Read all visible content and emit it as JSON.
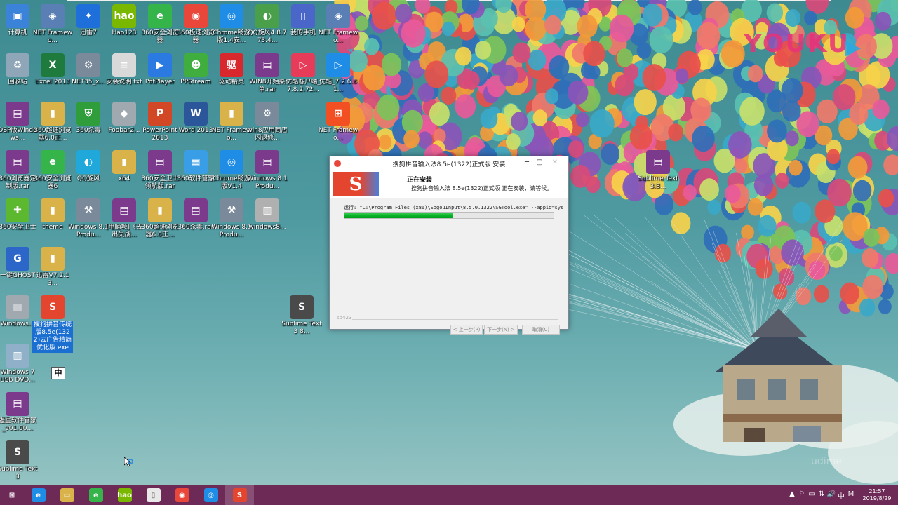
{
  "watermark": {
    "brand": "YOUKU",
    "corner": "udime"
  },
  "desktop_icons": [
    {
      "label": "计算机",
      "color": "#3b83d9",
      "glyph": "▣"
    },
    {
      "label": "NET Framewo...",
      "color": "#5a7fb5",
      "glyph": "◈"
    },
    {
      "label": "迅雷7",
      "color": "#1e6fd9",
      "glyph": "✦"
    },
    {
      "label": "Hao123",
      "color": "#7ab800",
      "glyph": "hao"
    },
    {
      "label": "360安全浏览器",
      "color": "#35b44a",
      "glyph": "e"
    },
    {
      "label": "360极速浏览器",
      "color": "#e8473a",
      "glyph": "◉"
    },
    {
      "label": "Chrome畅游版1.4安...",
      "color": "#1f8ce6",
      "glyph": "◎"
    },
    {
      "label": "QQ旋风4.8.773.4...",
      "color": "#4aa04a",
      "glyph": "◐"
    },
    {
      "label": "我的手机",
      "color": "#4a66c8",
      "glyph": "▯"
    },
    {
      "label": "NET Framewo...",
      "color": "#5a7fb5",
      "glyph": "◈"
    },
    {
      "label": "回收站",
      "color": "#8fa6b8",
      "glyph": "♻"
    },
    {
      "label": "Excel 2013",
      "color": "#1f7a3d",
      "glyph": "X"
    },
    {
      "label": "NET35_x...",
      "color": "#7a8a9a",
      "glyph": "⚙"
    },
    {
      "label": "安装说明.txt",
      "color": "#d9d9d9",
      "glyph": "≡"
    },
    {
      "label": "PotPlayer",
      "color": "#2a7ae2",
      "glyph": "▶"
    },
    {
      "label": "PPStream",
      "color": "#3fae3f",
      "glyph": "☻"
    },
    {
      "label": "驱动精灵",
      "color": "#d9272e",
      "glyph": "驱"
    },
    {
      "label": "WIN8开始菜单.rar",
      "color": "#7b3a8c",
      "glyph": "▤"
    },
    {
      "label": "优酷客户端_7.8.2.72...",
      "color": "#e63c5a",
      "glyph": "▷"
    },
    {
      "label": "优酷_7.2.6.81...",
      "color": "#1f8ce6",
      "glyph": "▷"
    },
    {
      "label": "DSP版Windows...",
      "color": "#7b3a8c",
      "glyph": "▤"
    },
    {
      "label": "360超速浏览器6.0正...",
      "color": "#d9b24a",
      "glyph": "▮"
    },
    {
      "label": "360杀毒",
      "color": "#2f9e3a",
      "glyph": "⛨"
    },
    {
      "label": "Foobar2...",
      "color": "#a0a8b0",
      "glyph": "◆"
    },
    {
      "label": "PowerPoint 2013",
      "color": "#d24726",
      "glyph": "P"
    },
    {
      "label": "Word 2013",
      "color": "#2b579a",
      "glyph": "W"
    },
    {
      "label": "NET Framewo...",
      "color": "#d9b24a",
      "glyph": "▮"
    },
    {
      "label": "win8应用商店闪退修...",
      "color": "#7a8a9a",
      "glyph": "⚙"
    },
    {
      "label": "NET Framewo...",
      "color": "#f25022",
      "glyph": "⊞"
    },
    {
      "label": "360浏览器定制版.rar",
      "color": "#7b3a8c",
      "glyph": "▤"
    },
    {
      "label": "360安全浏览器6",
      "color": "#35b44a",
      "glyph": "e"
    },
    {
      "label": "QQ旋风",
      "color": "#1fa8d9",
      "glyph": "◐"
    },
    {
      "label": "x64",
      "color": "#d9b24a",
      "glyph": "▮"
    },
    {
      "label": "360安全卫士领航版.rar",
      "color": "#7b3a8c",
      "glyph": "▤"
    },
    {
      "label": "360软件管家",
      "color": "#3a9ee6",
      "glyph": "▦"
    },
    {
      "label": "Chrome畅游版V1.4",
      "color": "#1f8ce6",
      "glyph": "◎"
    },
    {
      "label": "Windows 8.1 Produ...",
      "color": "#7b3a8c",
      "glyph": "▤"
    },
    {
      "label": "Sublime Text 3.8...",
      "color": "#7b3a8c",
      "glyph": "▤"
    },
    {
      "label": "360安全卫士",
      "color": "#5cb82e",
      "glyph": "✚"
    },
    {
      "label": "theme",
      "color": "#d9b24a",
      "glyph": "▮"
    },
    {
      "label": "Windows 8.1 Produ...",
      "color": "#7a8a9a",
      "glyph": "⚒"
    },
    {
      "label": "[电脑城]《去出失战...",
      "color": "#7b3a8c",
      "glyph": "▤"
    },
    {
      "label": "360超速浏览器6.0正...",
      "color": "#d9b24a",
      "glyph": "▮"
    },
    {
      "label": "360杀毒.rar",
      "color": "#7b3a8c",
      "glyph": "▤"
    },
    {
      "label": "Windows 8.1 Produ...",
      "color": "#7a8a9a",
      "glyph": "⚒"
    },
    {
      "label": "windows8...",
      "color": "#b0b0b0",
      "glyph": "▥"
    },
    {
      "label": "一键GHOST",
      "color": "#2b66c8",
      "glyph": "G"
    },
    {
      "label": "迅雷V7.2.13...",
      "color": "#d9b24a",
      "glyph": "▮"
    },
    {
      "label": "Windows...",
      "color": "#a0a8b0",
      "glyph": "▥"
    },
    {
      "label": "搜狗拼音传统版8.5e(1322)去广告精简优化版.exe",
      "color": "#e4452f",
      "glyph": "S"
    },
    {
      "label": "Sublime Text 3 8...",
      "color": "#4a4a4a",
      "glyph": "S"
    },
    {
      "label": "Windows 7 USB DVD...",
      "color": "#8fb0c8",
      "glyph": "▥"
    },
    {
      "label": "强星软件管家_v01.00...",
      "color": "#7b3a8c",
      "glyph": "▤"
    },
    {
      "label": "Sublime Text 3",
      "color": "#4a4a4a",
      "glyph": "S"
    }
  ],
  "ime_indicator": "中",
  "dialog": {
    "title": "搜狗拼音输入法8.5e(1322)正式版 安装",
    "logo_text": "S",
    "header_title": "正在安装",
    "header_sub": "搜狗拼音输入法 8.5e(1322)正式版 正在安装，请等候。",
    "run_text": "运行: \"C:\\Program Files (x86)\\SogouInput\\8.5.0.1322\\SGTool.exe\" --appid=sys",
    "progress": 0.52,
    "brand": "sd423",
    "btn_back": "< 上一步(P)",
    "btn_next": "下一步(N) >",
    "btn_cancel": "取消(C)",
    "ctrl_min": "─",
    "ctrl_max": "▢",
    "ctrl_close": "✕"
  },
  "taskbar": {
    "items": [
      {
        "name": "start",
        "glyph": "⊞",
        "color": "#6e2a57"
      },
      {
        "name": "ie",
        "glyph": "e",
        "color": "#1f8ce6"
      },
      {
        "name": "explorer",
        "glyph": "▭",
        "color": "#d9b24a"
      },
      {
        "name": "360-browser",
        "glyph": "e",
        "color": "#35b44a"
      },
      {
        "name": "hao123",
        "glyph": "hao",
        "color": "#7ab800"
      },
      {
        "name": "notepad",
        "glyph": "▯",
        "color": "#e8e8e8"
      },
      {
        "name": "360-speed",
        "glyph": "◉",
        "color": "#e8473a"
      },
      {
        "name": "chrome",
        "glyph": "◎",
        "color": "#1f8ce6"
      },
      {
        "name": "sogou-installer",
        "glyph": "S",
        "color": "#e4452f"
      }
    ],
    "tray": [
      "▲",
      "⚐",
      "▭",
      "⇅",
      "🔊",
      "中",
      "M"
    ],
    "time": "21:57",
    "date": "2019/8/29"
  }
}
